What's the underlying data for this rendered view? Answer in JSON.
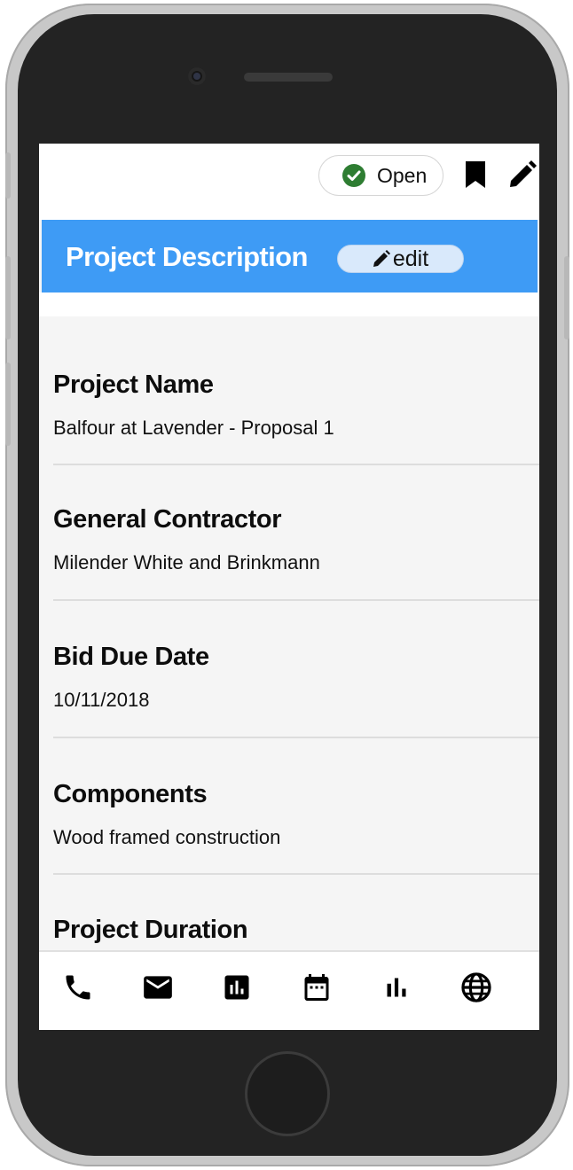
{
  "header": {
    "status_label": "Open",
    "status_color": "#2e7d32",
    "bookmark_icon": "bookmark-icon",
    "edit_icon": "pencil-icon"
  },
  "banner": {
    "title": "Project Description",
    "edit_label": "edit",
    "background": "#3e9bf5"
  },
  "fields": [
    {
      "title": "Project Name",
      "value": "Balfour at Lavender - Proposal 1"
    },
    {
      "title": "General Contractor",
      "value": "Milender White and Brinkmann"
    },
    {
      "title": "Bid Due Date",
      "value": "10/11/2018"
    },
    {
      "title": "Components",
      "value": "Wood framed construction"
    },
    {
      "title": "Project Duration",
      "value": ""
    }
  ],
  "bottom_nav": [
    {
      "icon": "phone-icon"
    },
    {
      "icon": "mail-icon"
    },
    {
      "icon": "report-icon"
    },
    {
      "icon": "calendar-icon"
    },
    {
      "icon": "bar-chart-icon"
    },
    {
      "icon": "globe-icon"
    }
  ]
}
